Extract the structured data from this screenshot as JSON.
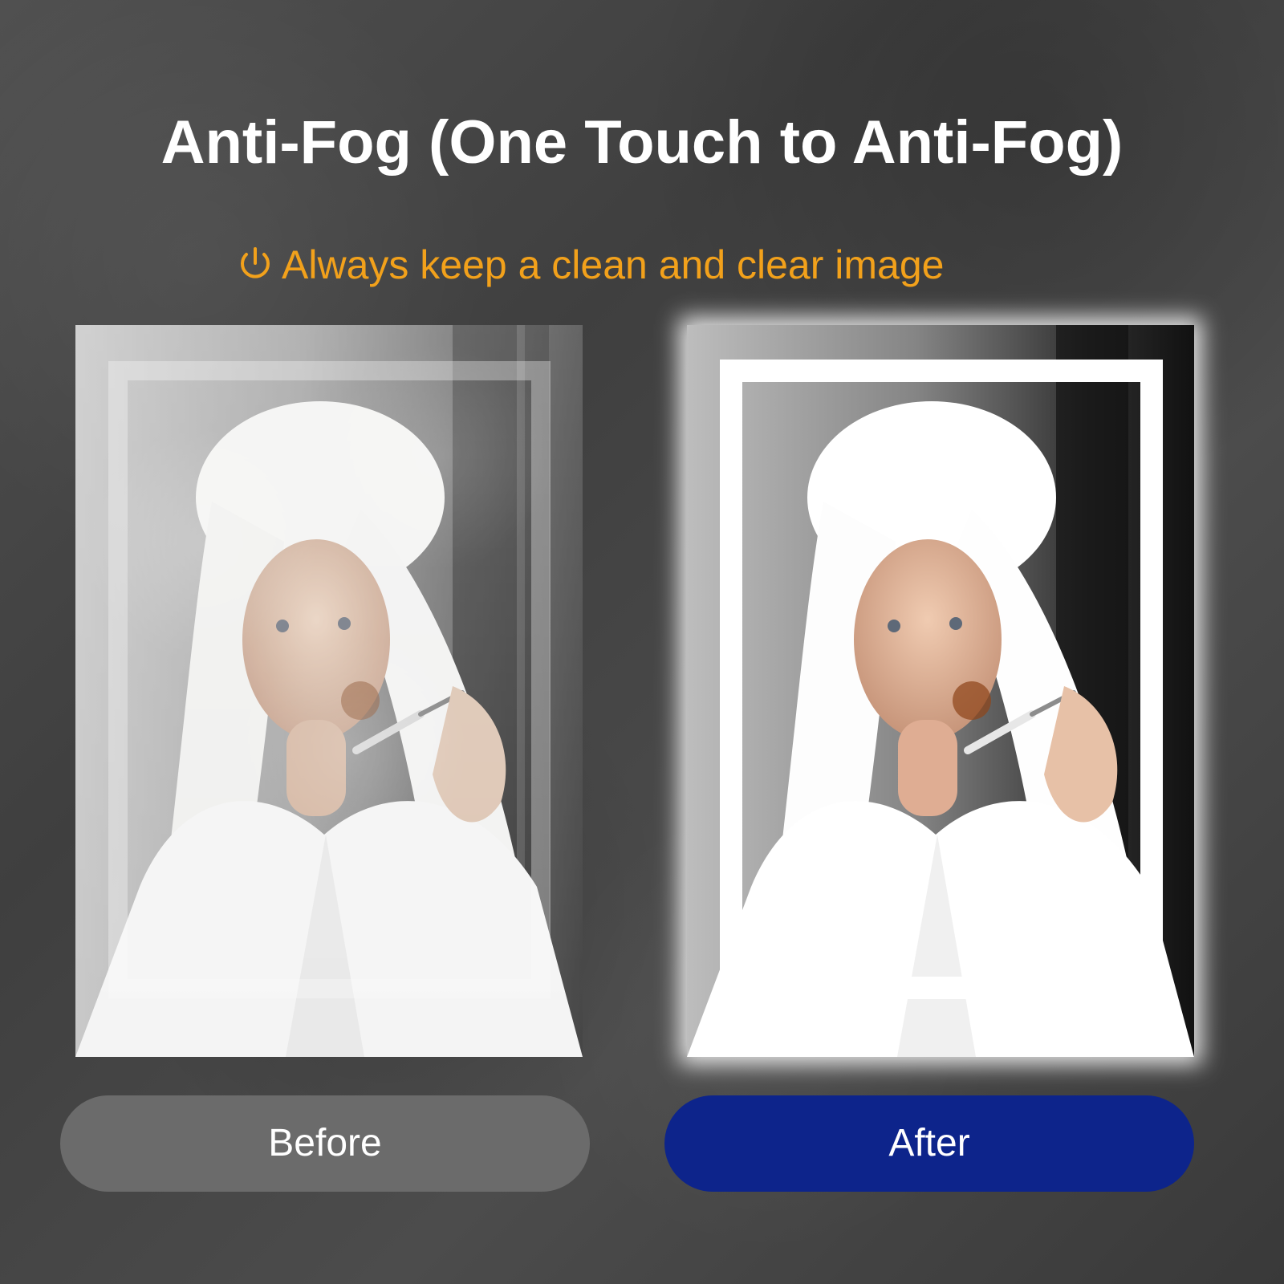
{
  "headline": "Anti-Fog (One Touch to Anti-Fog)",
  "subline": "Always keep a clean and clear image",
  "icons": {
    "power": "power-icon"
  },
  "colors": {
    "headline": "#ffffff",
    "subline": "#f2a11b",
    "before_pill": "#6b6b6b",
    "after_pill": "#0d248b"
  },
  "labels": {
    "before": "Before",
    "after": "After"
  }
}
